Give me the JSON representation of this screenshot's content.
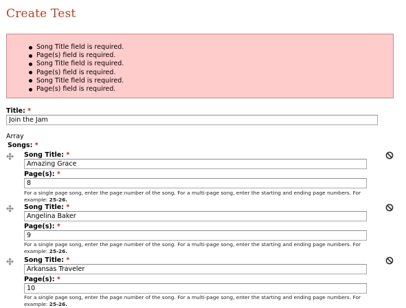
{
  "page": {
    "title": "Create Test"
  },
  "errors": [
    "Song Title field is required.",
    "Page(s) field is required.",
    "Song Title field is required.",
    "Page(s) field is required.",
    "Song Title field is required.",
    "Page(s) field is required."
  ],
  "form": {
    "title_label": "Title:",
    "title_value": "Join the Jam",
    "array_text": "Array",
    "songs_label": "Songs:",
    "required_mark": "*",
    "songs": [
      {
        "song_title_label": "Song Title:",
        "song_title_value": "Amazing Grace",
        "pages_label": "Page(s):",
        "pages_value": "8",
        "help_text": "For a single page song, enter the page number of the song. For a multi-page song, enter the starting and ending page numbers. For example:",
        "help_example": "25-26."
      },
      {
        "song_title_label": "Song Title:",
        "song_title_value": "Angelina Baker",
        "pages_label": "Page(s):",
        "pages_value": "9",
        "help_text": "For a single page song, enter the page number of the song. For a multi-page song, enter the starting and ending page numbers. For example:",
        "help_example": "25-26."
      },
      {
        "song_title_label": "Song Title:",
        "song_title_value": "Arkansas Traveler",
        "pages_label": "Page(s):",
        "pages_value": "10",
        "help_text": "For a single page song, enter the page number of the song. For a multi-page song, enter the starting and ending page numbers. For example:",
        "help_example": "25-26."
      }
    ]
  },
  "icons": {
    "drag": "move-arrows-icon",
    "remove": "remove-circle-icon"
  },
  "colors": {
    "title": "#b5422a",
    "error_bg": "#ffcccc",
    "error_border": "#c98a8a",
    "required": "#d32020"
  }
}
